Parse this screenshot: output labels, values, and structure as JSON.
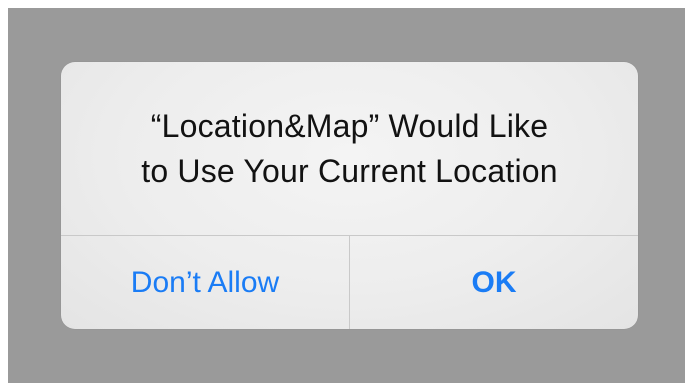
{
  "alert": {
    "title_line_1": "“Location&Map” Would Like",
    "title_line_2": "to Use Your Current Location",
    "buttons": {
      "cancel_label": "Don’t Allow",
      "confirm_label": "OK"
    }
  },
  "colors": {
    "backdrop": "#9a9a9a",
    "alert_background": "#efefef",
    "button_text": "#1a7cf5",
    "divider": "#c9c9c9",
    "message_text": "#121212"
  }
}
